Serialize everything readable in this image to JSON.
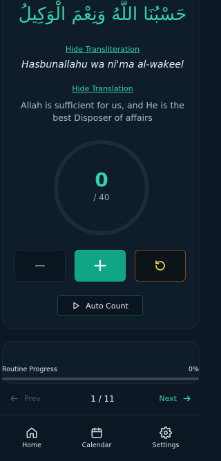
{
  "dhikr": {
    "arabic": "حَسْبُنَا اللَّهُ وَنِعْمَ الْوَكِيلُ",
    "hide_transliteration": "Hide Transliteration",
    "transliteration": "Hasbunallahu wa ni'ma al-wakeel",
    "hide_translation": "Hide Translation",
    "translation": "Allah is sufficient for us, and He is the best Disposer of affairs"
  },
  "counter": {
    "count": "0",
    "target": "/ 40",
    "auto_count_label": "Auto Count"
  },
  "progress": {
    "label": "Routine Progress",
    "value_text": "0%",
    "fraction": 0
  },
  "pager": {
    "prev_label": "Prev",
    "position": "1 / 11",
    "next_label": "Next"
  },
  "bottom_nav": {
    "home": "Home",
    "calendar": "Calendar",
    "settings": "Settings"
  },
  "colors": {
    "accent": "#34d3a6",
    "background": "#0c1824",
    "reset": "#f2c94c"
  }
}
